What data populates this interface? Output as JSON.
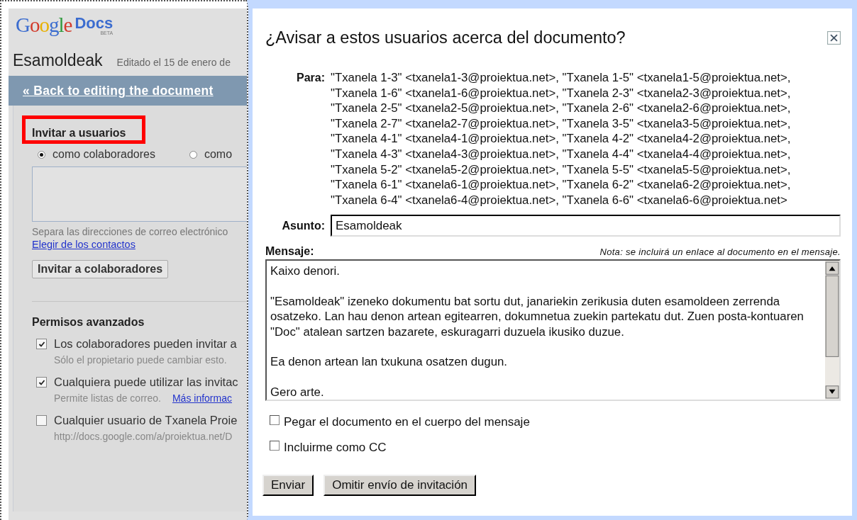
{
  "page": {
    "logo": {
      "google": "Google",
      "product": "Docs",
      "badge": "BETA"
    },
    "doc_title": "Esamoldeak",
    "edited": "Editado el 15 de enero de",
    "back_link": "« Back to editing the document",
    "invite": {
      "heading": "Invitar a usuarios",
      "roles": [
        {
          "label": "como colaboradores",
          "selected": true
        },
        {
          "label": "como",
          "selected": false
        }
      ],
      "hint": "Separa las direcciones de correo electrónico",
      "contacts_link": "Elegir de los contactos",
      "button": "Invitar a colaboradores"
    },
    "advanced": {
      "heading": "Permisos avanzados",
      "options": [
        {
          "label": "Los colaboradores pueden invitar a",
          "checked": true,
          "note": "Sólo el propietario puede cambiar esto."
        },
        {
          "label": "Cualquiera puede utilizar las invitac",
          "checked": true,
          "note": "Permite listas de correo.",
          "link": "Más informac"
        },
        {
          "label": "Cualquier usuario de Txanela Proie",
          "checked": false,
          "note": "http://docs.google.com/a/proiektua.net/D"
        }
      ]
    }
  },
  "dialog": {
    "title": "¿Avisar a estos usuarios acerca del documento?",
    "to_label": "Para:",
    "recipients": [
      "\"Txanela 1-3\" <txanela1-3@proiektua.net>, \"Txanela 1-5\" <txanela1-5@proiektua.net>,",
      "\"Txanela 1-6\" <txanela1-6@proiektua.net>, \"Txanela 2-3\" <txanela2-3@proiektua.net>,",
      "\"Txanela 2-5\" <txanela2-5@proiektua.net>, \"Txanela 2-6\" <txanela2-6@proiektua.net>,",
      "\"Txanela 2-7\" <txanela2-7@proiektua.net>, \"Txanela 3-5\" <txanela3-5@proiektua.net>,",
      "\"Txanela 4-1\" <txanela4-1@proiektua.net>, \"Txanela 4-2\" <txanela4-2@proiektua.net>,",
      "\"Txanela 4-3\" <txanela4-3@proiektua.net>, \"Txanela 4-4\" <txanela4-4@proiektua.net>,",
      "\"Txanela 5-2\" <txanela5-2@proiektua.net>, \"Txanela 5-5\" <txanela5-5@proiektua.net>,",
      "\"Txanela 6-1\" <txanela6-1@proiektua.net>, \"Txanela 6-2\" <txanela6-2@proiektua.net>,",
      "\"Txanela 6-4\" <txanela6-4@proiektua.net>, \"Txanela 6-6\" <txanela6-6@proiektua.net>"
    ],
    "subject_label": "Asunto:",
    "subject": "Esamoldeak",
    "message_label": "Mensaje:",
    "note": "Nota: se incluirá un enlace al documento en el mensaje.",
    "message": "Kaixo denori.\n\n\"Esamoldeak\" izeneko dokumentu bat sortu dut, janariekin zerikusia duten esamoldeen zerrenda osatzeko. Lan hau denon artean egitearren, dokumnetua zuekin partekatu dut. Zuen posta-kontuaren \"Doc\" atalean sartzen bazarete, eskuragarri duzuela ikusiko duzue.\n\nEa denon artean lan txukuna osatzen dugun.\n\nGero arte.",
    "options": [
      {
        "label": "Pegar el documento en el cuerpo del mensaje",
        "checked": false
      },
      {
        "label": "Incluirme como CC",
        "checked": false
      }
    ],
    "buttons": [
      "Enviar",
      "Omitir envío de invitación"
    ]
  }
}
